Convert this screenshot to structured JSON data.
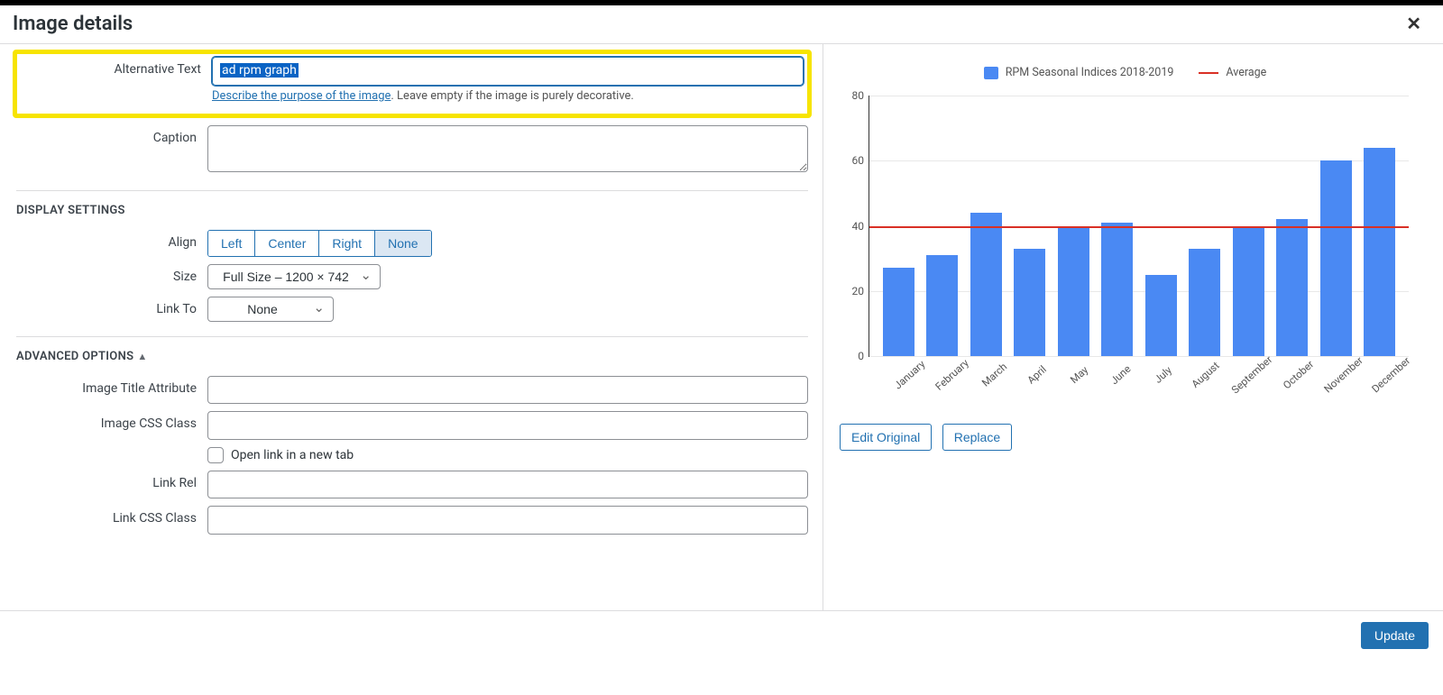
{
  "dialog": {
    "title": "Image details",
    "fields": {
      "alt_label": "Alternative Text",
      "alt_value": "ad rpm graph",
      "alt_hint_link": "Describe the purpose of the image",
      "alt_hint_rest": ". Leave empty if the image is purely decorative.",
      "caption_label": "Caption",
      "caption_value": ""
    },
    "display_section_title": "DISPLAY SETTINGS",
    "align": {
      "label": "Align",
      "options": [
        "Left",
        "Center",
        "Right",
        "None"
      ],
      "selected": "None"
    },
    "size": {
      "label": "Size",
      "selected": "Full Size – 1200 × 742"
    },
    "link_to": {
      "label": "Link To",
      "selected": "None"
    },
    "advanced_section_title": "ADVANCED OPTIONS",
    "advanced": {
      "title_attr_label": "Image Title Attribute",
      "title_attr_value": "",
      "css_class_label": "Image CSS Class",
      "css_class_value": "",
      "open_new_tab_label": "Open link in a new tab",
      "open_new_tab_checked": false,
      "link_rel_label": "Link Rel",
      "link_rel_value": "",
      "link_css_label": "Link CSS Class",
      "link_css_value": ""
    },
    "actions": {
      "edit_original": "Edit Original",
      "replace": "Replace",
      "update": "Update"
    }
  },
  "chart_data": {
    "type": "bar",
    "categories": [
      "January",
      "February",
      "March",
      "April",
      "May",
      "June",
      "July",
      "August",
      "September",
      "October",
      "November",
      "December"
    ],
    "series": [
      {
        "name": "RPM Seasonal Indices 2018-2019",
        "values": [
          27,
          31,
          44,
          33,
          40,
          41,
          25,
          33,
          40,
          42,
          60,
          64
        ]
      }
    ],
    "reference_lines": [
      {
        "name": "Average",
        "value": 40,
        "color": "#d93025"
      }
    ],
    "legend": [
      "RPM Seasonal Indices 2018-2019",
      "Average"
    ],
    "ylim": [
      0,
      80
    ],
    "yticks": [
      0,
      20,
      40,
      60,
      80
    ]
  },
  "colors": {
    "bar": "#4a89f3",
    "average_line": "#d93025",
    "primary_button": "#2271b1",
    "highlight": "#f7e400"
  }
}
